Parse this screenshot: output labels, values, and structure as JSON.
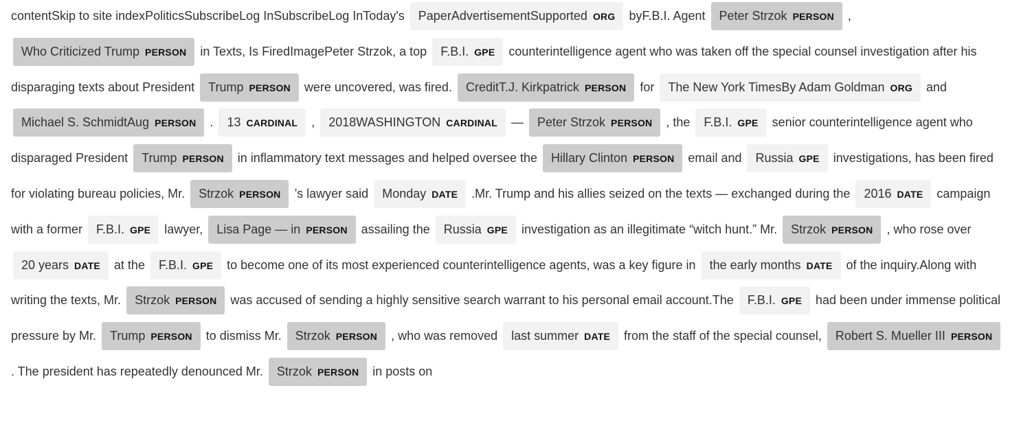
{
  "colors": {
    "person_bg": "#cccccc",
    "other_bg": "#f2f2f2",
    "text": "#333333"
  },
  "segments": [
    {
      "t": "contentSkip to site indexPoliticsSubscribeLog InSubscribeLog InToday's "
    },
    {
      "e": "PaperAdvertisementSupported",
      "l": "ORG"
    },
    {
      "t": " byF.B.I. Agent "
    },
    {
      "e": "Peter Strzok",
      "l": "PERSON"
    },
    {
      "t": " , "
    },
    {
      "e": "Who Criticized Trump",
      "l": "PERSON"
    },
    {
      "t": " in Texts, Is FiredImagePeter Strzok, a top "
    },
    {
      "e": "F.B.I.",
      "l": "GPE"
    },
    {
      "t": " counterintelligence agent who was taken off the special counsel investigation after his disparaging texts about President "
    },
    {
      "e": "Trump",
      "l": "PERSON"
    },
    {
      "t": " were uncovered, was fired. "
    },
    {
      "e": "CreditT.J. Kirkpatrick",
      "l": "PERSON"
    },
    {
      "t": " for "
    },
    {
      "e": "The New York TimesBy Adam Goldman",
      "l": "ORG"
    },
    {
      "t": " and "
    },
    {
      "e": "Michael S. SchmidtAug",
      "l": "PERSON"
    },
    {
      "t": " . "
    },
    {
      "e": "13",
      "l": "CARDINAL"
    },
    {
      "t": " , "
    },
    {
      "e": "2018WASHINGTON",
      "l": "CARDINAL"
    },
    {
      "t": " — "
    },
    {
      "e": "Peter Strzok",
      "l": "PERSON"
    },
    {
      "t": " , the "
    },
    {
      "e": "F.B.I.",
      "l": "GPE"
    },
    {
      "t": " senior counterintelligence agent who disparaged President "
    },
    {
      "e": "Trump",
      "l": "PERSON"
    },
    {
      "t": " in inflammatory text messages and helped oversee the "
    },
    {
      "e": "Hillary Clinton",
      "l": "PERSON"
    },
    {
      "t": " email and "
    },
    {
      "e": "Russia",
      "l": "GPE"
    },
    {
      "t": " investigations, has been fired for violating bureau policies, Mr. "
    },
    {
      "e": "Strzok",
      "l": "PERSON"
    },
    {
      "t": " ’s lawyer said "
    },
    {
      "e": "Monday",
      "l": "DATE"
    },
    {
      "t": " .Mr. Trump and his allies seized on the texts — exchanged during the "
    },
    {
      "e": "2016",
      "l": "DATE"
    },
    {
      "t": " campaign with a former "
    },
    {
      "e": "F.B.I.",
      "l": "GPE"
    },
    {
      "t": " lawyer, "
    },
    {
      "e": "Lisa Page — in",
      "l": "PERSON"
    },
    {
      "t": " assailing the "
    },
    {
      "e": "Russia",
      "l": "GPE"
    },
    {
      "t": " investigation as an illegitimate “witch hunt.” Mr. "
    },
    {
      "e": "Strzok",
      "l": "PERSON"
    },
    {
      "t": " , who rose over "
    },
    {
      "e": "20 years",
      "l": "DATE"
    },
    {
      "t": " at the "
    },
    {
      "e": "F.B.I.",
      "l": "GPE"
    },
    {
      "t": " to become one of its most experienced counterintelligence agents, was a key figure in "
    },
    {
      "e": "the early months",
      "l": "DATE"
    },
    {
      "t": " of the inquiry.Along with writing the texts, Mr. "
    },
    {
      "e": "Strzok",
      "l": "PERSON"
    },
    {
      "t": " was accused of sending a highly sensitive search warrant to his personal email account.The "
    },
    {
      "e": "F.B.I.",
      "l": "GPE"
    },
    {
      "t": " had been under immense political pressure by Mr. "
    },
    {
      "e": "Trump",
      "l": "PERSON"
    },
    {
      "t": " to dismiss Mr. "
    },
    {
      "e": "Strzok",
      "l": "PERSON"
    },
    {
      "t": " , who was removed "
    },
    {
      "e": "last summer",
      "l": "DATE"
    },
    {
      "t": " from the staff of the special counsel, "
    },
    {
      "e": "Robert S. Mueller III",
      "l": "PERSON"
    },
    {
      "t": " . The president has repeatedly denounced Mr. "
    },
    {
      "e": "Strzok",
      "l": "PERSON"
    },
    {
      "t": " in posts on"
    }
  ]
}
